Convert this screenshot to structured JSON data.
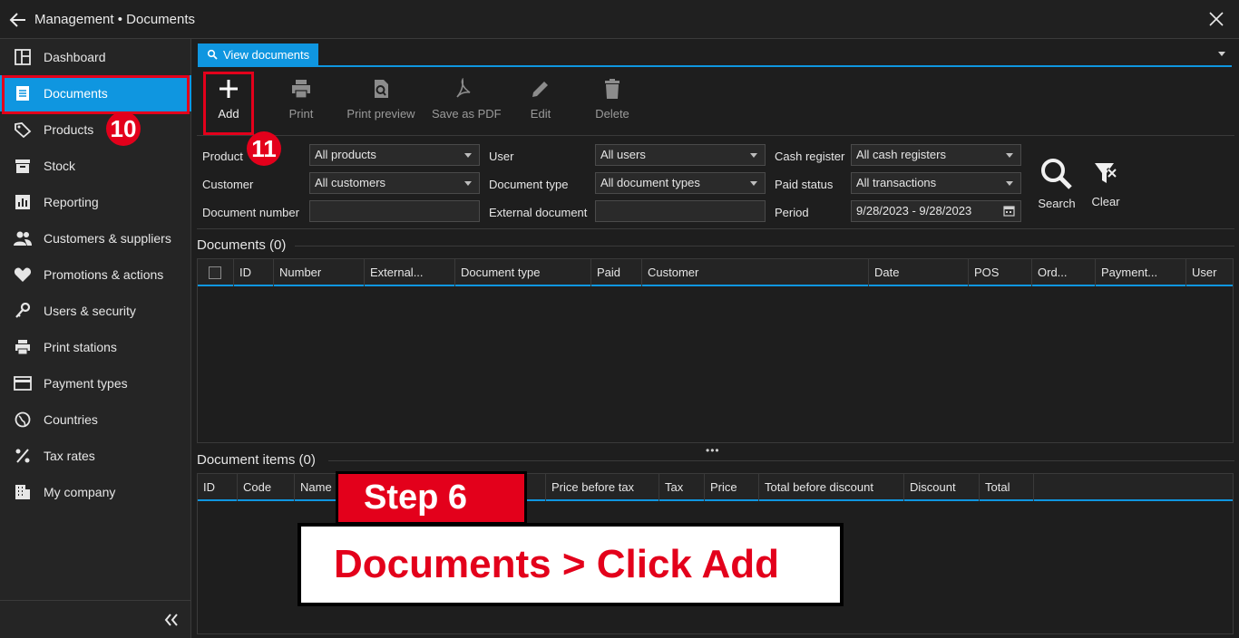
{
  "window": {
    "title": "Management • Documents"
  },
  "sidebar": {
    "items": [
      {
        "label": "Dashboard",
        "icon": "dashboard-icon"
      },
      {
        "label": "Documents",
        "icon": "document-icon"
      },
      {
        "label": "Products",
        "icon": "tag-icon"
      },
      {
        "label": "Stock",
        "icon": "box-icon"
      },
      {
        "label": "Reporting",
        "icon": "chart-icon"
      },
      {
        "label": "Customers & suppliers",
        "icon": "people-icon"
      },
      {
        "label": "Promotions & actions",
        "icon": "heart-icon"
      },
      {
        "label": "Users & security",
        "icon": "key-icon"
      },
      {
        "label": "Print stations",
        "icon": "printer-icon"
      },
      {
        "label": "Payment types",
        "icon": "card-icon"
      },
      {
        "label": "Countries",
        "icon": "globe-icon"
      },
      {
        "label": "Tax rates",
        "icon": "percent-icon"
      },
      {
        "label": "My company",
        "icon": "building-icon"
      }
    ],
    "active": "Documents"
  },
  "tab": {
    "label": "View documents"
  },
  "toolbar": {
    "add": "Add",
    "print": "Print",
    "print_preview": "Print preview",
    "save_pdf": "Save as PDF",
    "edit": "Edit",
    "delete": "Delete"
  },
  "filters": {
    "product_label": "Product",
    "product_value": "All products",
    "customer_label": "Customer",
    "customer_value": "All customers",
    "docnum_label": "Document number",
    "docnum_value": "",
    "user_label": "User",
    "user_value": "All users",
    "doctype_label": "Document type",
    "doctype_value": "All document types",
    "extdoc_label": "External document",
    "extdoc_value": "",
    "cashreg_label": "Cash register",
    "cashreg_value": "All cash registers",
    "paid_label": "Paid status",
    "paid_value": "All transactions",
    "period_label": "Period",
    "period_value": "9/28/2023 - 9/28/2023",
    "search": "Search",
    "clear": "Clear"
  },
  "documents": {
    "title": "Documents (0)",
    "columns": [
      "ID",
      "Number",
      "External...",
      "Document type",
      "Paid",
      "Customer",
      "Date",
      "POS",
      "Ord...",
      "Payment...",
      "User"
    ]
  },
  "items": {
    "title": "Document items (0)",
    "columns": [
      "ID",
      "Code",
      "Name",
      "Price before tax",
      "Tax",
      "Price",
      "Total before discount",
      "Discount",
      "Total"
    ]
  },
  "overlay": {
    "badge_documents": "10",
    "badge_add": "11",
    "step": "Step 6",
    "caption": "Documents > Click Add"
  },
  "colors": {
    "accent": "#0f96e0",
    "highlight": "#e3001b",
    "background": "#1e1e1e"
  }
}
